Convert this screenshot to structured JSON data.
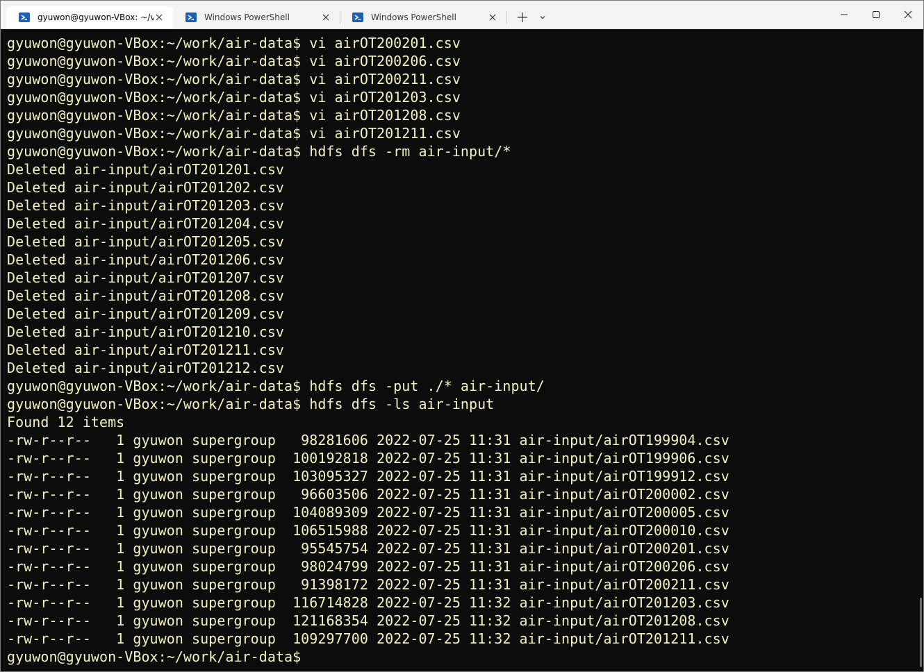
{
  "tabs": [
    {
      "label": "gyuwon@gyuwon-VBox: ~/v",
      "active": true
    },
    {
      "label": "Windows PowerShell",
      "active": false
    },
    {
      "label": "Windows PowerShell",
      "active": false
    }
  ],
  "colors": {
    "terminal_bg": "#0c0c0c",
    "terminal_fg": "#f2f2bf",
    "tab_icon": "#1f5fb4"
  },
  "icons": {
    "tab": "powershell-icon",
    "close": "close-icon",
    "new_tab": "plus-icon",
    "dropdown": "chevron-down-icon",
    "minimize": "minimize-icon",
    "maximize": "maximize-icon",
    "window_close": "close-icon"
  },
  "terminal": {
    "lines": [
      "gyuwon@gyuwon-VBox:~/work/air-data$ vi airOT200201.csv",
      "gyuwon@gyuwon-VBox:~/work/air-data$ vi airOT200206.csv",
      "gyuwon@gyuwon-VBox:~/work/air-data$ vi airOT200211.csv",
      "gyuwon@gyuwon-VBox:~/work/air-data$ vi airOT201203.csv",
      "gyuwon@gyuwon-VBox:~/work/air-data$ vi airOT201208.csv",
      "gyuwon@gyuwon-VBox:~/work/air-data$ vi airOT201211.csv",
      "gyuwon@gyuwon-VBox:~/work/air-data$ hdfs dfs -rm air-input/*",
      "Deleted air-input/airOT201201.csv",
      "Deleted air-input/airOT201202.csv",
      "Deleted air-input/airOT201203.csv",
      "Deleted air-input/airOT201204.csv",
      "Deleted air-input/airOT201205.csv",
      "Deleted air-input/airOT201206.csv",
      "Deleted air-input/airOT201207.csv",
      "Deleted air-input/airOT201208.csv",
      "Deleted air-input/airOT201209.csv",
      "Deleted air-input/airOT201210.csv",
      "Deleted air-input/airOT201211.csv",
      "Deleted air-input/airOT201212.csv",
      "gyuwon@gyuwon-VBox:~/work/air-data$ hdfs dfs -put ./* air-input/",
      "gyuwon@gyuwon-VBox:~/work/air-data$ hdfs dfs -ls air-input",
      "Found 12 items",
      "-rw-r--r--   1 gyuwon supergroup   98281606 2022-07-25 11:31 air-input/airOT199904.csv",
      "-rw-r--r--   1 gyuwon supergroup  100192818 2022-07-25 11:31 air-input/airOT199906.csv",
      "-rw-r--r--   1 gyuwon supergroup  103095327 2022-07-25 11:31 air-input/airOT199912.csv",
      "-rw-r--r--   1 gyuwon supergroup   96603506 2022-07-25 11:31 air-input/airOT200002.csv",
      "-rw-r--r--   1 gyuwon supergroup  104089309 2022-07-25 11:31 air-input/airOT200005.csv",
      "-rw-r--r--   1 gyuwon supergroup  106515988 2022-07-25 11:31 air-input/airOT200010.csv",
      "-rw-r--r--   1 gyuwon supergroup   95545754 2022-07-25 11:31 air-input/airOT200201.csv",
      "-rw-r--r--   1 gyuwon supergroup   98024799 2022-07-25 11:31 air-input/airOT200206.csv",
      "-rw-r--r--   1 gyuwon supergroup   91398172 2022-07-25 11:31 air-input/airOT200211.csv",
      "-rw-r--r--   1 gyuwon supergroup  116714828 2022-07-25 11:32 air-input/airOT201203.csv",
      "-rw-r--r--   1 gyuwon supergroup  121168354 2022-07-25 11:32 air-input/airOT201208.csv",
      "-rw-r--r--   1 gyuwon supergroup  109297700 2022-07-25 11:32 air-input/airOT201211.csv",
      "gyuwon@gyuwon-VBox:~/work/air-data$"
    ]
  }
}
